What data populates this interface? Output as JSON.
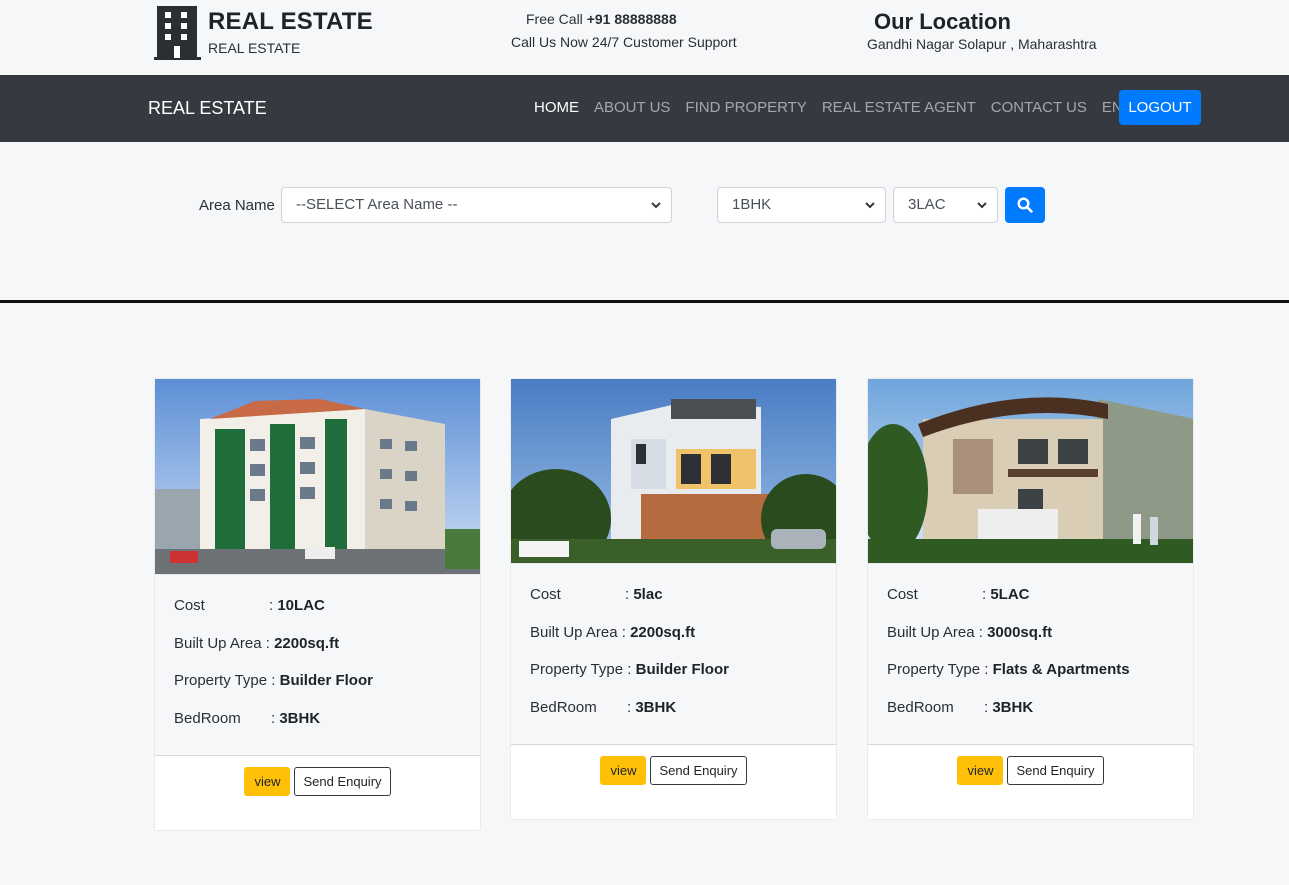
{
  "header": {
    "brand_title": "REAL ESTATE",
    "brand_subtitle": "REAL ESTATE",
    "call_prefix": "Free Call ",
    "call_number": "+91 88888888",
    "support_text": "Call Us Now 24/7 Customer Support",
    "location_title": "Our Location",
    "location_address": "Gandhi Nagar Solapur , Maharashtra"
  },
  "nav": {
    "brand": "REAL ESTATE",
    "links": [
      "HOME",
      "ABOUT US",
      "FIND PROPERTY",
      "REAL ESTATE AGENT",
      "CONTACT US",
      "ENQUIRY"
    ],
    "logout": "LOGOUT"
  },
  "search": {
    "area_label": "Area Name",
    "area_value": "--SELECT Area Name --",
    "bhk_value": "1BHK",
    "price_value": "3LAC"
  },
  "cards": [
    {
      "cost_label": "Cost",
      "cost": "10LAC",
      "area_label": "Built Up Area",
      "area": "2200sq.ft",
      "type_label": "Property Type",
      "type": "Builder Floor",
      "bedroom_label": "BedRoom",
      "bedroom": "3BHK",
      "view": "view",
      "enquiry": "Send Enquiry"
    },
    {
      "cost_label": "Cost",
      "cost": "5lac",
      "area_label": "Built Up Area",
      "area": "2200sq.ft",
      "type_label": "Property Type",
      "type": "Builder Floor",
      "bedroom_label": "BedRoom",
      "bedroom": "3BHK",
      "view": "view",
      "enquiry": "Send Enquiry"
    },
    {
      "cost_label": "Cost",
      "cost": "5LAC",
      "area_label": "Built Up Area",
      "area": "3000sq.ft",
      "type_label": "Property Type",
      "type": "Flats & Apartments",
      "bedroom_label": "BedRoom",
      "bedroom": "3BHK",
      "view": "view",
      "enquiry": "Send Enquiry"
    }
  ],
  "colors": {
    "navbar": "#343a40",
    "primary": "#007bff",
    "warning": "#ffc107"
  }
}
